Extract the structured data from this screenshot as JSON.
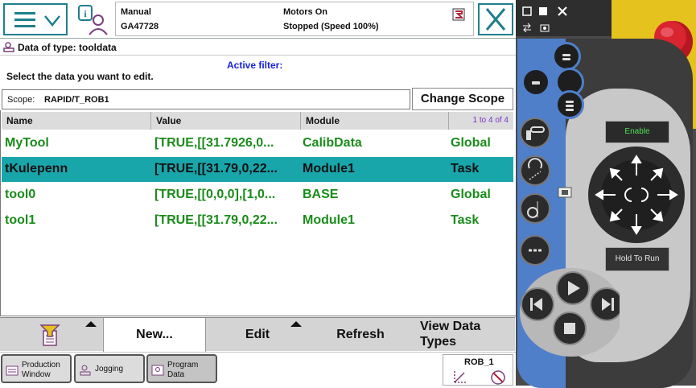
{
  "topbar": {
    "mode": "Manual",
    "controller": "GA47728",
    "motors": "Motors On",
    "state": "Stopped (Speed 100%)"
  },
  "header": {
    "title": "Data of type: tooldata"
  },
  "filter": {
    "label": "Active filter:"
  },
  "instruction": "Select the data you want to edit.",
  "scope": {
    "label": "Scope:",
    "value": "RAPID/T_ROB1",
    "button": "Change Scope"
  },
  "table": {
    "columns": [
      "Name",
      "Value",
      "Module",
      ""
    ],
    "count": "1 to 4 of 4",
    "rows": [
      {
        "name": "MyTool",
        "value": "[TRUE,[[31.7926,0...",
        "module": "CalibData",
        "scope": "Global",
        "selected": false
      },
      {
        "name": "tKulepenn",
        "value": "[TRUE,[[31.79,0,22...",
        "module": "Module1",
        "scope": "Task",
        "selected": true
      },
      {
        "name": "tool0",
        "value": "[TRUE,[[0,0,0],[1,0...",
        "module": "BASE",
        "scope": "Global",
        "selected": false
      },
      {
        "name": "tool1",
        "value": "[TRUE,[[31.79,0,22...",
        "module": "Module1",
        "scope": "Task",
        "selected": false
      }
    ]
  },
  "commands": {
    "new": "New...",
    "edit": "Edit",
    "refresh": "Refresh",
    "view_types": "View Data Types"
  },
  "taskbar": [
    {
      "label": "Production Window"
    },
    {
      "label": "Jogging"
    },
    {
      "label": "Program Data"
    }
  ],
  "robot": {
    "name": "ROB_1"
  },
  "pendant": {
    "enable": "Enable",
    "hold_to_run": "Hold To Run"
  },
  "colors": {
    "accent": "#1f7f8c",
    "selected_row": "#18a6ab",
    "data_text": "#1a8c1a",
    "filter_text": "#1a23d9"
  }
}
